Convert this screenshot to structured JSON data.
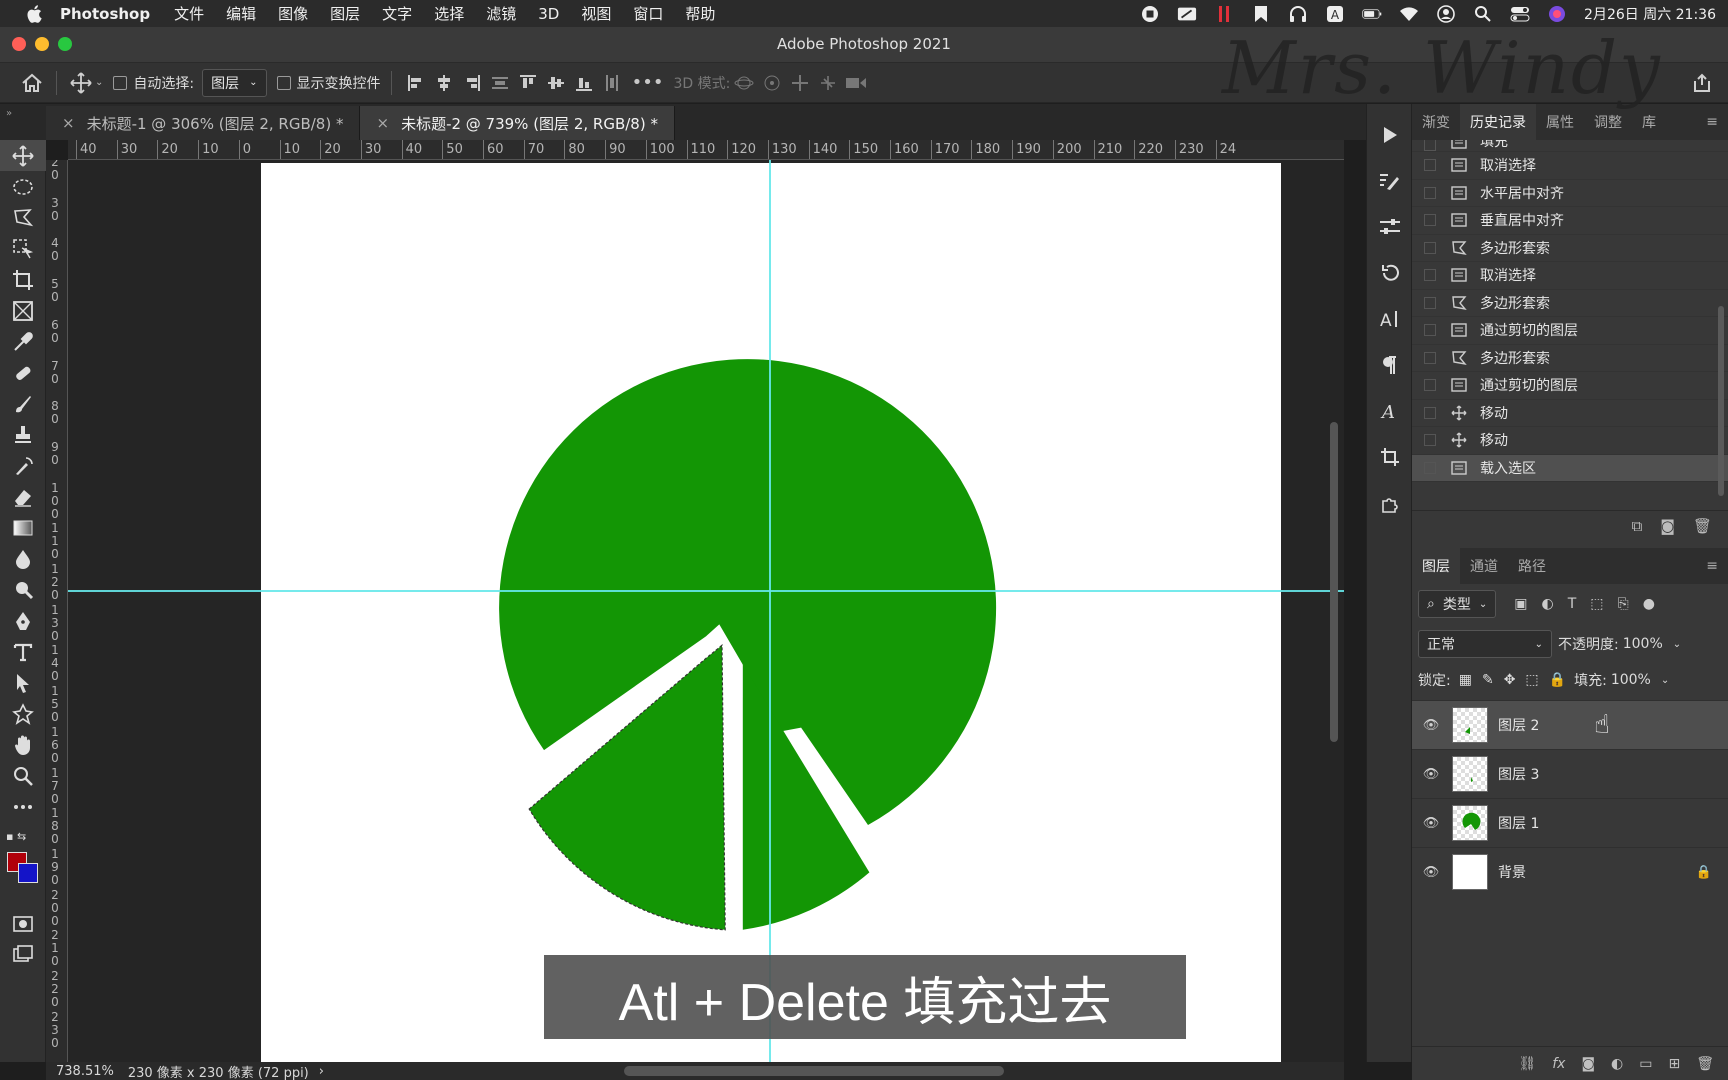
{
  "menubar": {
    "app_name": "Photoshop",
    "items": [
      "文件",
      "编辑",
      "图像",
      "图层",
      "文字",
      "选择",
      "滤镜",
      "3D",
      "视图",
      "窗口",
      "帮助"
    ],
    "clock": "2月26日 周六 21:36"
  },
  "window": {
    "title": "Adobe Photoshop 2021"
  },
  "options": {
    "auto_select_label": "自动选择:",
    "auto_select_target": "图层",
    "show_transform_label": "显示变换控件",
    "mode_3d_label": "3D 模式:"
  },
  "tabs": [
    {
      "label": "未标题-1 @ 306% (图层 2, RGB/8) *"
    },
    {
      "label": "未标题-2 @ 739% (图层 2, RGB/8) *"
    }
  ],
  "ruler_top": [
    "40",
    "30",
    "20",
    "10",
    "0",
    "10",
    "20",
    "30",
    "40",
    "50",
    "60",
    "70",
    "80",
    "90",
    "100",
    "110",
    "120",
    "130",
    "140",
    "150",
    "160",
    "170",
    "180",
    "190",
    "200",
    "210",
    "220",
    "230",
    "24"
  ],
  "ruler_left": [
    "2 0",
    "3 0",
    "4 0",
    "5 0",
    "6 0",
    "7 0",
    "8 0",
    "9 0",
    "1 0 0",
    "1 1 0",
    "1 2 0",
    "1 3 0",
    "1 4 0",
    "1 5 0",
    "1 6 0",
    "1 7 0",
    "1 8 0",
    "1 9 0",
    "2 0 0",
    "2 1 0",
    "2 2 0",
    "2 3 0"
  ],
  "caption": "Atl + Delete 填充过去",
  "status": {
    "zoom": "738.51%",
    "doc_info": "230 像素 x 230 像素 (72 ppi)",
    "arrow": "›"
  },
  "colors": {
    "foreground": "#b0000a",
    "background": "#1414c8",
    "shape_green": "#139605",
    "guide": "#66e8ea"
  },
  "history_panel": {
    "tabs": [
      "渐变",
      "历史记录",
      "属性",
      "调整",
      "库"
    ],
    "active_tab": "历史记录",
    "items": [
      {
        "label": "填充",
        "icon": "doc-icon"
      },
      {
        "label": "取消选择",
        "icon": "doc-icon"
      },
      {
        "label": "水平居中对齐",
        "icon": "doc-icon"
      },
      {
        "label": "垂直居中对齐",
        "icon": "doc-icon"
      },
      {
        "label": "多边形套索",
        "icon": "lasso-icon"
      },
      {
        "label": "取消选择",
        "icon": "doc-icon"
      },
      {
        "label": "多边形套索",
        "icon": "lasso-icon"
      },
      {
        "label": "通过剪切的图层",
        "icon": "doc-icon"
      },
      {
        "label": "多边形套索",
        "icon": "lasso-icon"
      },
      {
        "label": "通过剪切的图层",
        "icon": "doc-icon"
      },
      {
        "label": "移动",
        "icon": "move-icon"
      },
      {
        "label": "移动",
        "icon": "move-icon"
      },
      {
        "label": "载入选区",
        "icon": "doc-icon"
      }
    ]
  },
  "layers_panel": {
    "tabs": [
      "图层",
      "通道",
      "路径"
    ],
    "filter_label": "类型",
    "blend_mode": "正常",
    "opacity_label": "不透明度:",
    "opacity_value": "100%",
    "lock_label": "锁定:",
    "fill_label": "填充:",
    "fill_value": "100%",
    "layers": [
      {
        "name": "图层 2",
        "selected": true
      },
      {
        "name": "图层 3",
        "selected": false
      },
      {
        "name": "图层 1",
        "selected": false
      },
      {
        "name": "背景",
        "selected": false,
        "locked": true
      }
    ]
  },
  "watermark": "Mrs. Windy"
}
